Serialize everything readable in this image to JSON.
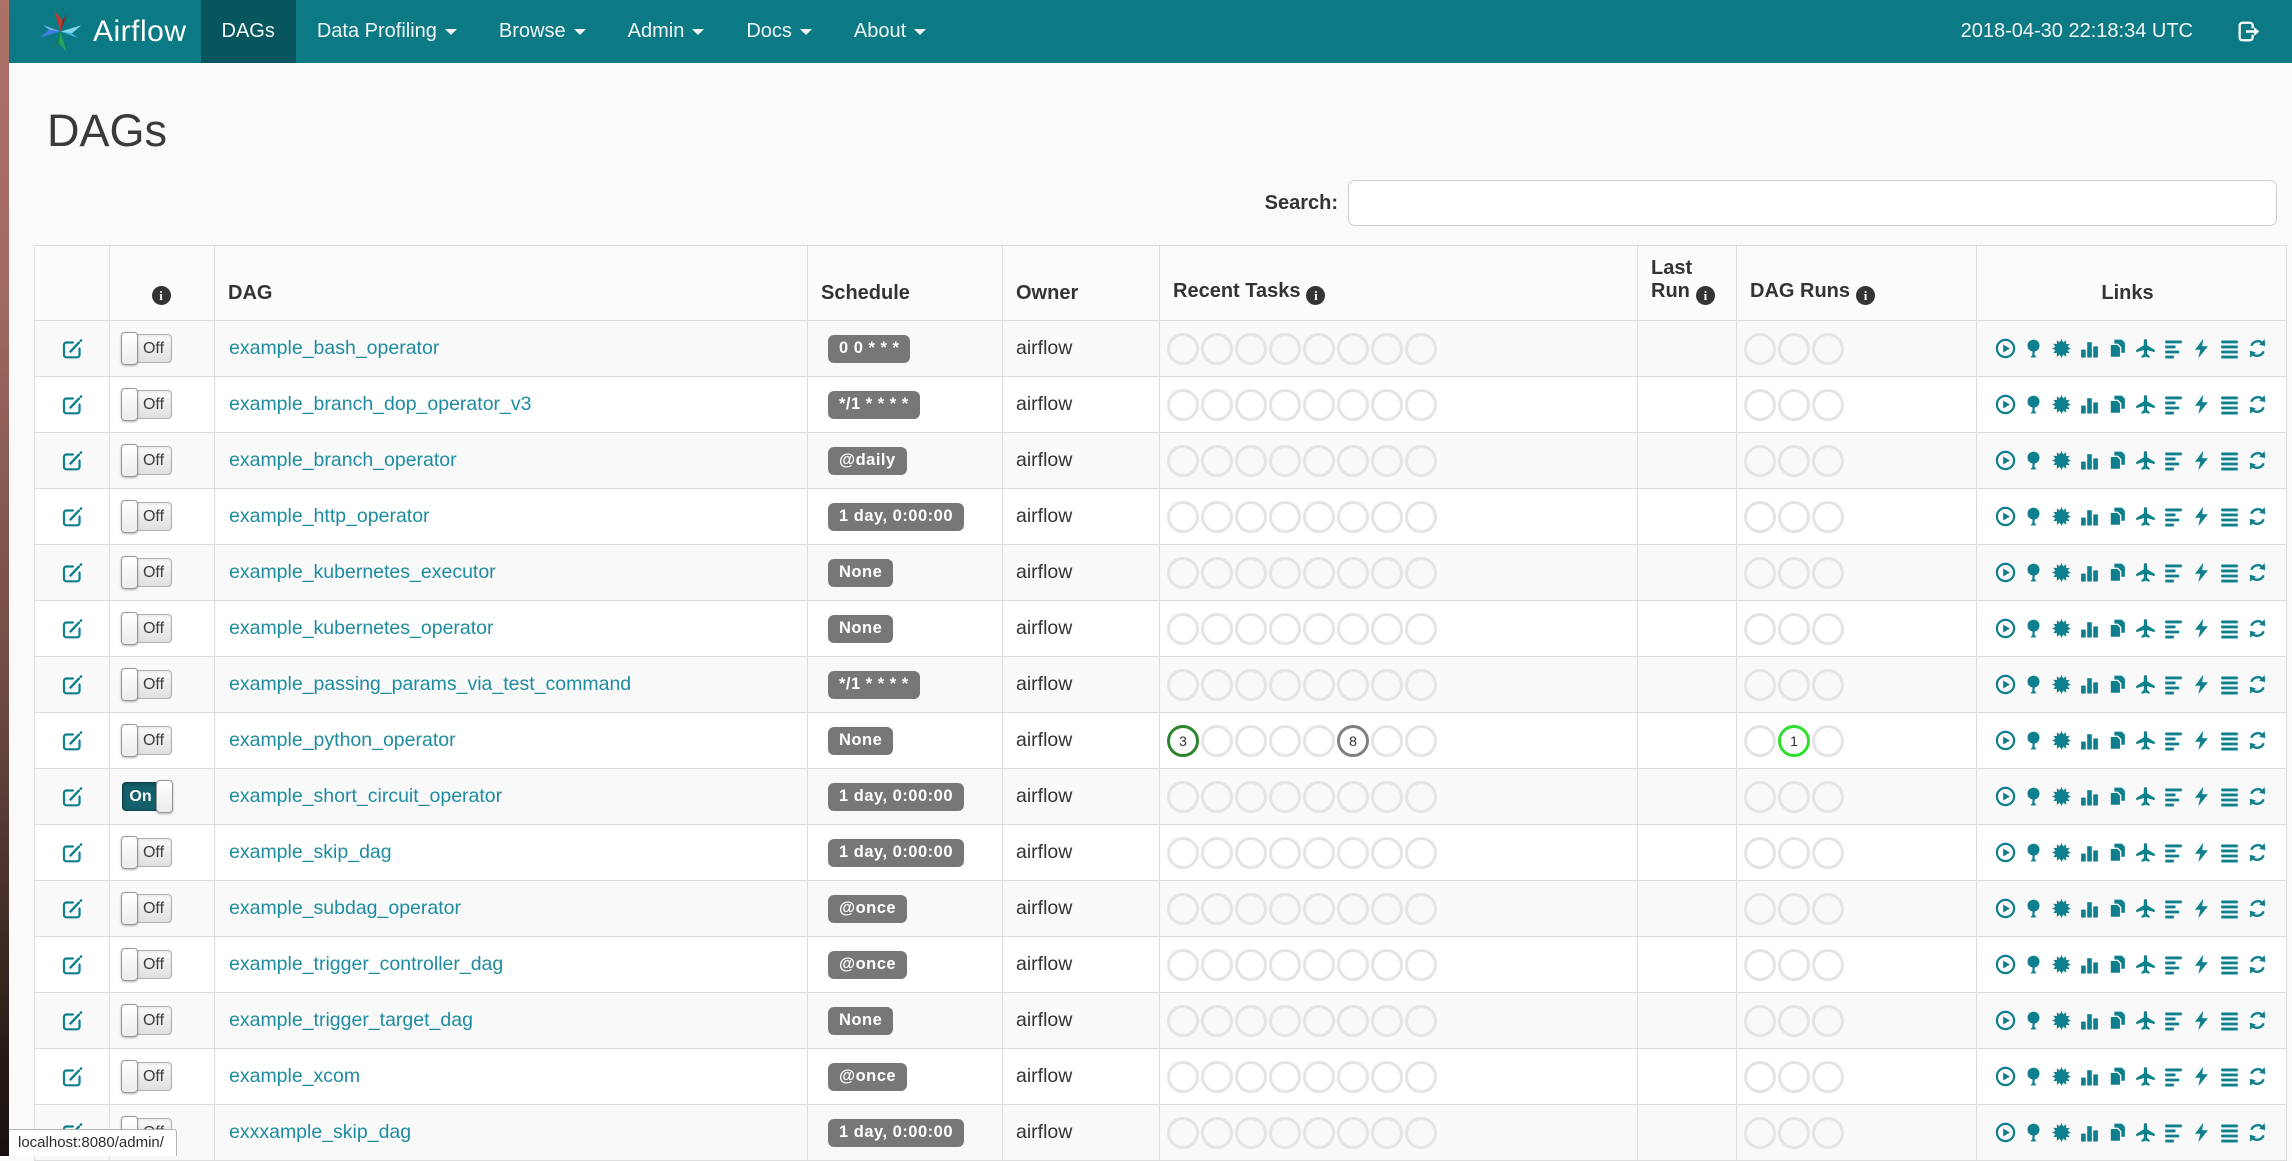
{
  "navbar": {
    "brand": "Airflow",
    "items": [
      {
        "label": "DAGs",
        "active": true,
        "dropdown": false
      },
      {
        "label": "Data Profiling",
        "active": false,
        "dropdown": true
      },
      {
        "label": "Browse",
        "active": false,
        "dropdown": true
      },
      {
        "label": "Admin",
        "active": false,
        "dropdown": true
      },
      {
        "label": "Docs",
        "active": false,
        "dropdown": true
      },
      {
        "label": "About",
        "active": false,
        "dropdown": true
      }
    ],
    "clock": "2018-04-30 22:18:34 UTC"
  },
  "page": {
    "title": "DAGs",
    "search_label": "Search:",
    "status_bar": "localhost:8080/admin/"
  },
  "colors": {
    "navbar_bg": "#0c7a84",
    "navbar_active_bg": "#07565e",
    "teal_link": "#1e8ca0",
    "teal_icon": "#0e7f8c",
    "badge_bg": "#777777",
    "toggle_on_bg": "#14616b",
    "circle_empty": "#e4e4e6",
    "success_green": "#2d862d",
    "queued_gray": "#808080",
    "running_lime": "#2ee02e"
  },
  "table": {
    "headers": {
      "dag": "DAG",
      "schedule": "Schedule",
      "owner": "Owner",
      "recent_tasks": "Recent Tasks",
      "last_run": "Last Run",
      "dag_runs": "DAG Runs",
      "links": "Links"
    },
    "recent_tasks_slots": 8,
    "dag_runs_slots": 3,
    "links": [
      {
        "name": "trigger-dag",
        "icon": "play-circle"
      },
      {
        "name": "tree-view",
        "icon": "tree"
      },
      {
        "name": "graph-view",
        "icon": "sunburst"
      },
      {
        "name": "task-duration",
        "icon": "bar-chart"
      },
      {
        "name": "task-tries",
        "icon": "copy-pages"
      },
      {
        "name": "landing-times",
        "icon": "plane"
      },
      {
        "name": "gantt-view",
        "icon": "align-left"
      },
      {
        "name": "code-view",
        "icon": "bolt"
      },
      {
        "name": "logs",
        "icon": "align-justify"
      },
      {
        "name": "refresh",
        "icon": "refresh"
      }
    ],
    "rows": [
      {
        "dag_id": "example_bash_operator",
        "toggle": "Off",
        "schedule": "0 0 * * *",
        "owner": "airflow",
        "recent_tasks": [],
        "dag_runs": []
      },
      {
        "dag_id": "example_branch_dop_operator_v3",
        "toggle": "Off",
        "schedule": "*/1 * * * *",
        "owner": "airflow",
        "recent_tasks": [],
        "dag_runs": []
      },
      {
        "dag_id": "example_branch_operator",
        "toggle": "Off",
        "schedule": "@daily",
        "owner": "airflow",
        "recent_tasks": [],
        "dag_runs": []
      },
      {
        "dag_id": "example_http_operator",
        "toggle": "Off",
        "schedule": "1 day, 0:00:00",
        "owner": "airflow",
        "recent_tasks": [],
        "dag_runs": []
      },
      {
        "dag_id": "example_kubernetes_executor",
        "toggle": "Off",
        "schedule": "None",
        "owner": "airflow",
        "recent_tasks": [],
        "dag_runs": []
      },
      {
        "dag_id": "example_kubernetes_operator",
        "toggle": "Off",
        "schedule": "None",
        "owner": "airflow",
        "recent_tasks": [],
        "dag_runs": []
      },
      {
        "dag_id": "example_passing_params_via_test_command",
        "toggle": "Off",
        "schedule": "*/1 * * * *",
        "owner": "airflow",
        "recent_tasks": [],
        "dag_runs": []
      },
      {
        "dag_id": "example_python_operator",
        "toggle": "Off",
        "schedule": "None",
        "owner": "airflow",
        "recent_tasks": [
          {
            "slot": 1,
            "count": "3",
            "state": "success",
            "color": "#2d862d"
          },
          {
            "slot": 6,
            "count": "8",
            "state": "queued",
            "color": "#808080"
          }
        ],
        "dag_runs": [
          {
            "slot": 2,
            "count": "1",
            "state": "running",
            "color": "#2ee02e"
          }
        ]
      },
      {
        "dag_id": "example_short_circuit_operator",
        "toggle": "On",
        "schedule": "1 day, 0:00:00",
        "owner": "airflow",
        "recent_tasks": [],
        "dag_runs": []
      },
      {
        "dag_id": "example_skip_dag",
        "toggle": "Off",
        "schedule": "1 day, 0:00:00",
        "owner": "airflow",
        "recent_tasks": [],
        "dag_runs": []
      },
      {
        "dag_id": "example_subdag_operator",
        "toggle": "Off",
        "schedule": "@once",
        "owner": "airflow",
        "recent_tasks": [],
        "dag_runs": []
      },
      {
        "dag_id": "example_trigger_controller_dag",
        "toggle": "Off",
        "schedule": "@once",
        "owner": "airflow",
        "recent_tasks": [],
        "dag_runs": []
      },
      {
        "dag_id": "example_trigger_target_dag",
        "toggle": "Off",
        "schedule": "None",
        "owner": "airflow",
        "recent_tasks": [],
        "dag_runs": []
      },
      {
        "dag_id": "example_xcom",
        "toggle": "Off",
        "schedule": "@once",
        "owner": "airflow",
        "recent_tasks": [],
        "dag_runs": []
      },
      {
        "dag_id": "exxxample_skip_dag",
        "toggle": "Off",
        "schedule": "1 day, 0:00:00",
        "owner": "airflow",
        "recent_tasks": [],
        "dag_runs": []
      }
    ]
  }
}
